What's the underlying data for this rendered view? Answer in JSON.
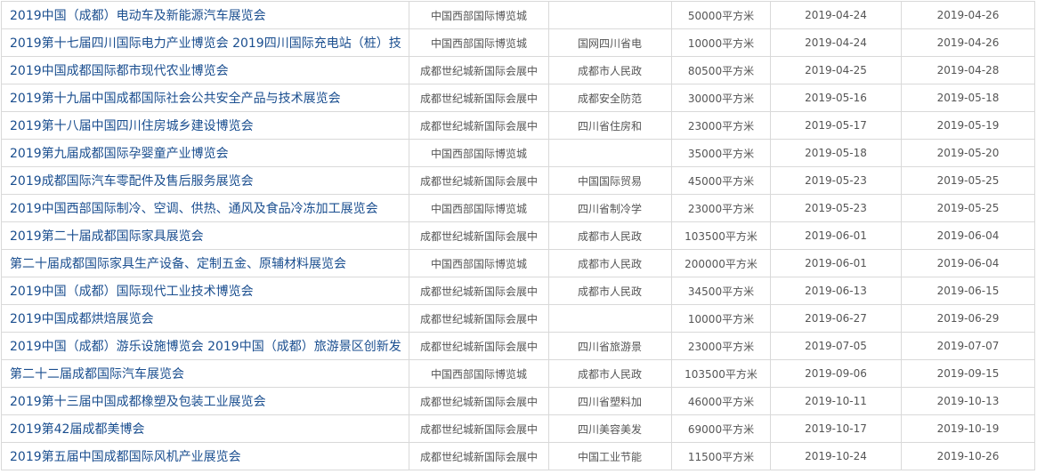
{
  "exhibitions": [
    {
      "name": "2019中国（成都）电动车及新能源汽车展览会",
      "venue": "中国西部国际博览城",
      "organizer": "",
      "area": "50000平方米",
      "start_date": "2019-04-24",
      "end_date": "2019-04-26"
    },
    {
      "name": "2019第十七届四川国际电力产业博览会 2019四川国际充电站（桩）技",
      "venue": "中国西部国际博览城",
      "organizer": "国网四川省电",
      "area": "10000平方米",
      "start_date": "2019-04-24",
      "end_date": "2019-04-26"
    },
    {
      "name": "2019中国成都国际都市现代农业博览会",
      "venue": "成都世纪城新国际会展中",
      "organizer": "成都市人民政",
      "area": "80500平方米",
      "start_date": "2019-04-25",
      "end_date": "2019-04-28"
    },
    {
      "name": "2019第十九届中国成都国际社会公共安全产品与技术展览会",
      "venue": "成都世纪城新国际会展中",
      "organizer": "成都安全防范",
      "area": "30000平方米",
      "start_date": "2019-05-16",
      "end_date": "2019-05-18"
    },
    {
      "name": "2019第十八届中国四川住房城乡建设博览会",
      "venue": "成都世纪城新国际会展中",
      "organizer": "四川省住房和",
      "area": "23000平方米",
      "start_date": "2019-05-17",
      "end_date": "2019-05-19"
    },
    {
      "name": "2019第九届成都国际孕婴童产业博览会",
      "venue": "中国西部国际博览城",
      "organizer": "",
      "area": "35000平方米",
      "start_date": "2019-05-18",
      "end_date": "2019-05-20"
    },
    {
      "name": "2019成都国际汽车零配件及售后服务展览会",
      "venue": "成都世纪城新国际会展中",
      "organizer": "中国国际贸易",
      "area": "45000平方米",
      "start_date": "2019-05-23",
      "end_date": "2019-05-25"
    },
    {
      "name": "2019中国西部国际制冷、空调、供热、通风及食品冷冻加工展览会",
      "venue": "中国西部国际博览城",
      "organizer": "四川省制冷学",
      "area": "23000平方米",
      "start_date": "2019-05-23",
      "end_date": "2019-05-25"
    },
    {
      "name": "2019第二十届成都国际家具展览会",
      "venue": "成都世纪城新国际会展中",
      "organizer": "成都市人民政",
      "area": "103500平方米",
      "start_date": "2019-06-01",
      "end_date": "2019-06-04"
    },
    {
      "name": "第二十届成都国际家具生产设备、定制五金、原辅材料展览会",
      "venue": "中国西部国际博览城",
      "organizer": "成都市人民政",
      "area": "200000平方米",
      "start_date": "2019-06-01",
      "end_date": "2019-06-04"
    },
    {
      "name": "2019中国（成都）国际现代工业技术博览会",
      "venue": "成都世纪城新国际会展中",
      "organizer": "成都市人民政",
      "area": "34500平方米",
      "start_date": "2019-06-13",
      "end_date": "2019-06-15"
    },
    {
      "name": "2019中国成都烘焙展览会",
      "venue": "成都世纪城新国际会展中",
      "organizer": "",
      "area": "10000平方米",
      "start_date": "2019-06-27",
      "end_date": "2019-06-29"
    },
    {
      "name": "2019中国（成都）游乐设施博览会 2019中国（成都）旅游景区创新发",
      "venue": "成都世纪城新国际会展中",
      "organizer": "四川省旅游景",
      "area": "23000平方米",
      "start_date": "2019-07-05",
      "end_date": "2019-07-07"
    },
    {
      "name": "第二十二届成都国际汽车展览会",
      "venue": "中国西部国际博览城",
      "organizer": "成都市人民政",
      "area": "103500平方米",
      "start_date": "2019-09-06",
      "end_date": "2019-09-15"
    },
    {
      "name": "2019第十三届中国成都橡塑及包装工业展览会",
      "venue": "成都世纪城新国际会展中",
      "organizer": "四川省塑料加",
      "area": "46000平方米",
      "start_date": "2019-10-11",
      "end_date": "2019-10-13"
    },
    {
      "name": "2019第42届成都美博会",
      "venue": "成都世纪城新国际会展中",
      "organizer": "四川美容美发",
      "area": "69000平方米",
      "start_date": "2019-10-17",
      "end_date": "2019-10-19"
    },
    {
      "name": "2019第五届中国成都国际风机产业展览会",
      "venue": "成都世纪城新国际会展中",
      "organizer": "中国工业节能",
      "area": "11500平方米",
      "start_date": "2019-10-24",
      "end_date": "2019-10-26"
    }
  ]
}
